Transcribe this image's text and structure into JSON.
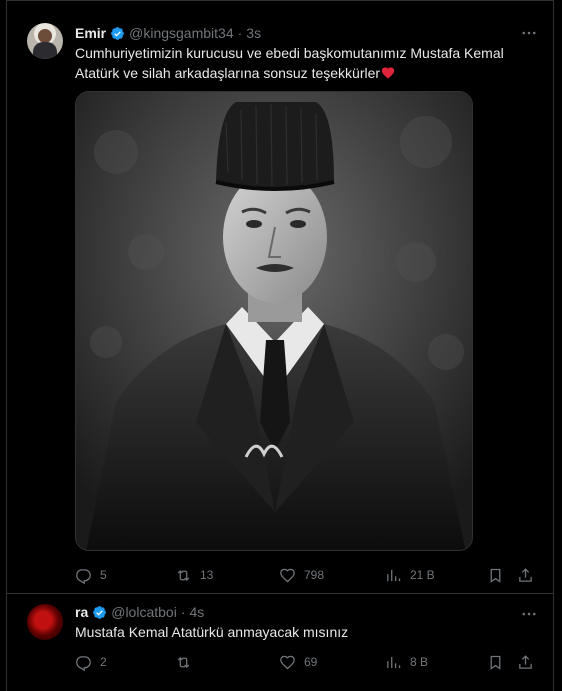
{
  "tweets": [
    {
      "author": {
        "name": "Emir",
        "handle": "@kingsgambit34",
        "verified": true
      },
      "separator": "·",
      "time": "3s",
      "text": "Cumhuriyetimizin kurucusu ve ebedi başkomutanımız Mustafa Kemal Atatürk ve silah arkadaşlarına sonsuz teşekkürler",
      "emoji": "red-heart-icon",
      "has_media": true,
      "stats": {
        "replies": "5",
        "retweets": "13",
        "likes": "798",
        "views": "21 B"
      }
    },
    {
      "author": {
        "name": "ra",
        "handle": "@lolcatboi",
        "verified": true
      },
      "separator": "·",
      "time": "4s",
      "text": "Mustafa Kemal Atatürkü anmayacak mısınız",
      "has_media": false,
      "stats": {
        "replies": "2",
        "retweets": "",
        "likes": "69",
        "views": "8 B"
      }
    }
  ],
  "colors": {
    "background": "#000000",
    "text_primary": "#e7e9ea",
    "text_secondary": "#71767b",
    "border": "#2f3336",
    "verified_badge": "#1d9bf0",
    "heart": "#f91880"
  }
}
